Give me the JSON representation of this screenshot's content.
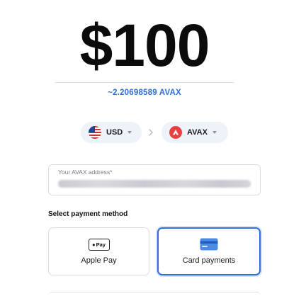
{
  "amount": {
    "display": "$100",
    "converted": "~2.20698589 AVAX"
  },
  "from_currency": {
    "code": "USD",
    "icon": "us-flag-icon"
  },
  "to_currency": {
    "code": "AVAX",
    "icon": "avalanche-logo-icon",
    "brand_color": "#e84142"
  },
  "address": {
    "label": "Your AVAX address*",
    "value_state": "blurred"
  },
  "payment": {
    "section_title": "Select payment method",
    "methods": [
      {
        "label": "Apple Pay",
        "badge_text": "Pay",
        "icon": "apple-pay-icon",
        "selected": false
      },
      {
        "label": "Card payments",
        "icon": "credit-card-icon",
        "selected": true
      }
    ]
  },
  "colors": {
    "accent": "#2f6fd8",
    "pill_bg": "#eef2f9",
    "border": "#d8dce2"
  }
}
